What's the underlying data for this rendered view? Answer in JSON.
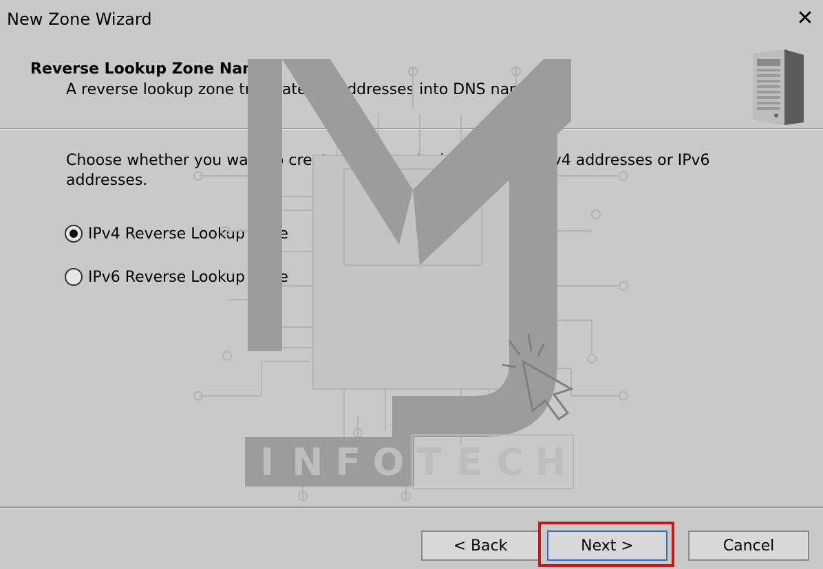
{
  "window": {
    "title": "New Zone Wizard",
    "close_glyph": "✕"
  },
  "header": {
    "title": "Reverse Lookup Zone Name",
    "description": "A reverse lookup zone translates IP addresses into DNS names.",
    "icon": "server-icon"
  },
  "content": {
    "instructions": "Choose whether you want to create a reverse lookup zone for IPv4 addresses or IPv6 addresses.",
    "options": [
      {
        "label": "IPv4 Reverse Lookup Zone",
        "selected": true
      },
      {
        "label": "IPv6 Reverse Lookup Zone",
        "selected": false
      }
    ]
  },
  "footer": {
    "back_label": "< Back",
    "next_label": "Next >",
    "cancel_label": "Cancel"
  },
  "watermark": {
    "letters": [
      "I",
      "N",
      "F",
      "O",
      "T",
      "E",
      "C",
      "H"
    ]
  },
  "colors": {
    "highlight": "#c8161d",
    "default_button_border": "#2a6fb8"
  }
}
